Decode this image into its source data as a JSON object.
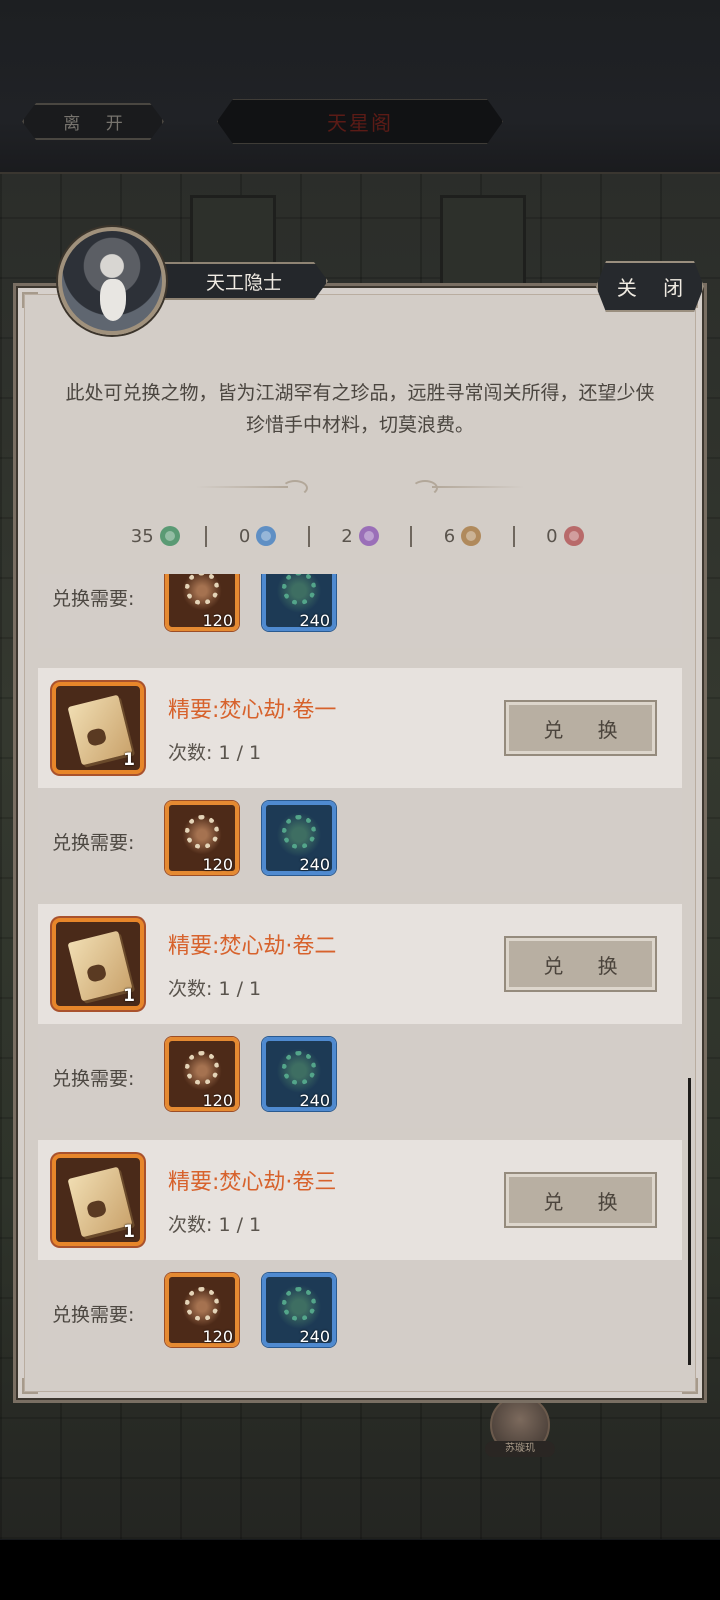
{
  "topbar": {
    "leave_label": "离 开",
    "location_label": "天星阁"
  },
  "npc": {
    "name": "天工隐士",
    "close_label": "关 闭"
  },
  "description": "此处可兑换之物，皆为江湖罕有之珍品，远胜寻常闯关所得，还望少侠珍惜手中材料，切莫浪费。",
  "currencies": [
    {
      "amount": "35",
      "icon": "green-gear-gem-icon",
      "color": "#5a9a74"
    },
    {
      "amount": "0",
      "icon": "blue-gear-gem-icon",
      "color": "#5f8fc4"
    },
    {
      "amount": "2",
      "icon": "purple-gear-gem-icon",
      "color": "#9a6fb8"
    },
    {
      "amount": "6",
      "icon": "bronze-gear-gem-icon",
      "color": "#b08a5c"
    },
    {
      "amount": "0",
      "icon": "red-gear-gem-icon",
      "color": "#b86a6a"
    }
  ],
  "requirement_label": "兑换需要:",
  "exchange_label": "兑 换",
  "count_prefix": "次数:",
  "partial_requirement": {
    "materials": [
      {
        "icon": "bronze-emblem-icon",
        "qty": "120"
      },
      {
        "icon": "jade-gear-icon",
        "qty": "240"
      }
    ]
  },
  "items": [
    {
      "title": "精要:焚心劫·卷一",
      "qty": "1",
      "count": "1 / 1",
      "icon": "manual-book-icon",
      "materials": [
        {
          "icon": "bronze-emblem-icon",
          "qty": "120"
        },
        {
          "icon": "jade-gear-icon",
          "qty": "240"
        }
      ]
    },
    {
      "title": "精要:焚心劫·卷二",
      "qty": "1",
      "count": "1 / 1",
      "icon": "manual-book-icon",
      "materials": [
        {
          "icon": "bronze-emblem-icon",
          "qty": "120"
        },
        {
          "icon": "jade-gear-icon",
          "qty": "240"
        }
      ]
    },
    {
      "title": "精要:焚心劫·卷三",
      "qty": "1",
      "count": "1 / 1",
      "icon": "manual-book-icon",
      "materials": [
        {
          "icon": "bronze-emblem-icon",
          "qty": "120"
        },
        {
          "icon": "jade-gear-icon",
          "qty": "240"
        }
      ]
    }
  ],
  "background_character": {
    "name": "苏璇玑"
  },
  "colors": {
    "item_title": "#d7622c",
    "panel_bg": "#d6d0cb",
    "item_frame": "#e7862a",
    "material_blue": "#4f8ad0"
  }
}
